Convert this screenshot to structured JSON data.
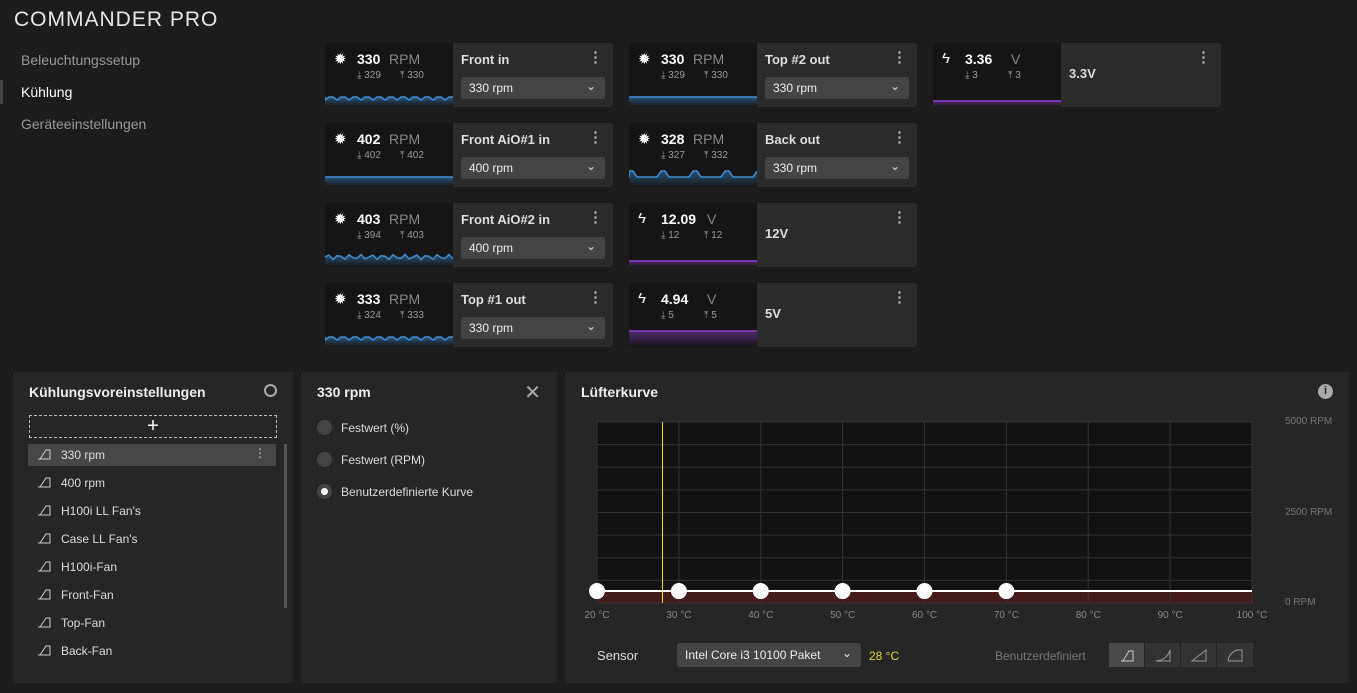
{
  "app_title": "COMMANDER PRO",
  "nav": [
    "Beleuchtungssetup",
    "Kühlung",
    "Geräteeinstellungen"
  ],
  "cards": [
    {
      "type": "fan",
      "value": "330",
      "unit": "RPM",
      "min": "329",
      "max": "330",
      "name": "Front in",
      "preset": "330 rpm"
    },
    {
      "type": "fan",
      "value": "402",
      "unit": "RPM",
      "min": "402",
      "max": "402",
      "name": "Front AiO#1 in",
      "preset": "400 rpm"
    },
    {
      "type": "fan",
      "value": "403",
      "unit": "RPM",
      "min": "394",
      "max": "403",
      "name": "Front AiO#2 in",
      "preset": "400 rpm"
    },
    {
      "type": "fan",
      "value": "333",
      "unit": "RPM",
      "min": "324",
      "max": "333",
      "name": "Top #1 out",
      "preset": "330 rpm"
    },
    {
      "type": "fan",
      "value": "330",
      "unit": "RPM",
      "min": "329",
      "max": "330",
      "name": "Top #2 out",
      "preset": "330 rpm"
    },
    {
      "type": "fan",
      "value": "328",
      "unit": "RPM",
      "min": "327",
      "max": "332",
      "name": "Back out",
      "preset": "330 rpm"
    },
    {
      "type": "volt",
      "value": "12.09",
      "unit": "V",
      "min": "12",
      "max": "12",
      "name": "12V"
    },
    {
      "type": "volt",
      "value": "4.94",
      "unit": "V",
      "min": "5",
      "max": "5",
      "name": "5V"
    },
    {
      "type": "volt",
      "value": "3.36",
      "unit": "V",
      "min": "3",
      "max": "3",
      "name": "3.3V"
    }
  ],
  "presets_panel": {
    "title": "Kühlungsvoreinstellungen",
    "items": [
      "330 rpm",
      "400 rpm",
      "H100i LL Fan's",
      "Case LL Fan's",
      "H100i-Fan",
      "Front-Fan",
      "Top-Fan",
      "Back-Fan"
    ]
  },
  "mode_panel": {
    "title": "330 rpm",
    "options": [
      "Festwert (%)",
      "Festwert (RPM)",
      "Benutzerdefinierte Kurve"
    ],
    "selected": 2
  },
  "curve_panel": {
    "title": "Lüfterkurve",
    "sensor_label": "Sensor",
    "sensor": "Intel Core i3 10100 Paket",
    "sensor_temp": "28 °C",
    "mode_label": "Benutzerdefiniert"
  },
  "chart_data": {
    "type": "line",
    "title": "Lüfterkurve",
    "x": [
      20,
      30,
      40,
      50,
      60,
      70
    ],
    "y": [
      330,
      330,
      330,
      330,
      330,
      330
    ],
    "xlim": [
      20,
      100
    ],
    "ylim": [
      0,
      5000
    ],
    "xticks": [
      "20 °C",
      "30 °C",
      "40 °C",
      "50 °C",
      "60 °C",
      "70 °C",
      "80 °C",
      "90 °C",
      "100 °C"
    ],
    "yticks": [
      "5000 RPM",
      "2500 RPM",
      "0 RPM"
    ],
    "current_temp": 28,
    "grid": true,
    "colors": {
      "line": "#ffffff",
      "marker": "#f0e020",
      "fill": "#5a1e1e"
    }
  }
}
